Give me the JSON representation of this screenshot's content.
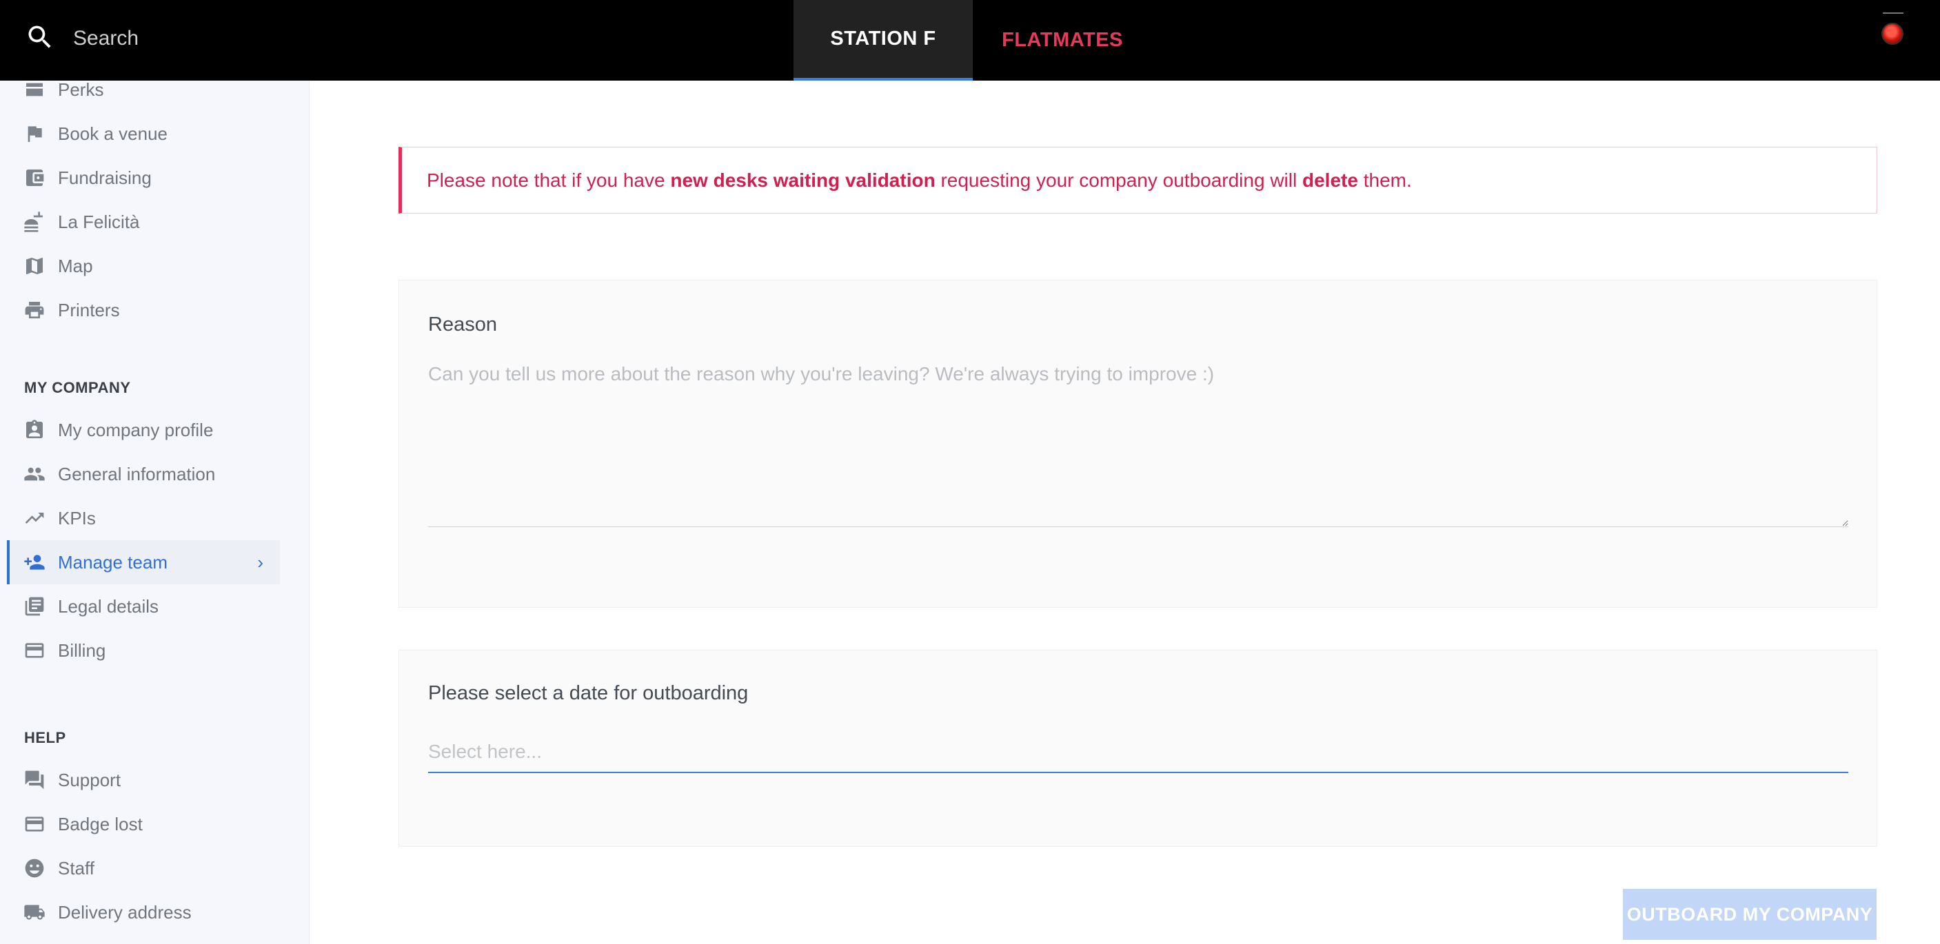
{
  "topbar": {
    "search_placeholder": "Search",
    "tabs": [
      {
        "label": "STATION F",
        "active": true
      },
      {
        "label": "FLATMATES",
        "active": false
      }
    ],
    "colors": {
      "background": "#000000",
      "active_tab_bg": "#222222",
      "accent": "#3b7be6",
      "secondary_tab": "#e8385b"
    }
  },
  "sidebar": {
    "top_items": [
      {
        "label": "Perks",
        "icon": "perks-icon"
      },
      {
        "label": "Book a venue",
        "icon": "flag-icon"
      },
      {
        "label": "Fundraising",
        "icon": "wallet-icon"
      },
      {
        "label": "La Felicità",
        "icon": "food-icon"
      },
      {
        "label": "Map",
        "icon": "map-icon"
      },
      {
        "label": "Printers",
        "icon": "printer-icon"
      }
    ],
    "sections": [
      {
        "title": "MY COMPANY",
        "items": [
          {
            "label": "My company profile",
            "icon": "badge-icon"
          },
          {
            "label": "General information",
            "icon": "people-icon"
          },
          {
            "label": "KPIs",
            "icon": "trending-icon"
          },
          {
            "label": "Manage team",
            "icon": "add-person-icon",
            "active": true
          },
          {
            "label": "Legal details",
            "icon": "library-icon"
          },
          {
            "label": "Billing",
            "icon": "credit-card-icon"
          }
        ]
      },
      {
        "title": "HELP",
        "items": [
          {
            "label": "Support",
            "icon": "chat-icon"
          },
          {
            "label": "Badge lost",
            "icon": "credit-card-icon"
          },
          {
            "label": "Staff",
            "icon": "face-icon"
          },
          {
            "label": "Delivery address",
            "icon": "truck-icon"
          }
        ]
      }
    ],
    "colors": {
      "background": "#f5f7fc",
      "active": "#2f6fd6",
      "text": "#70757d"
    }
  },
  "main": {
    "alert": {
      "prefix": "Please note that if you have ",
      "bold1": "new desks waiting validation",
      "middle": " requesting your company outboarding will ",
      "bold2": "delete",
      "suffix": " them.",
      "color": "#d02050"
    },
    "reason": {
      "label": "Reason",
      "placeholder": "Can you tell us more about the reason why you're leaving? We're always trying to improve :)",
      "value": ""
    },
    "date": {
      "label": "Please select a date for outboarding",
      "placeholder": "Select here..."
    },
    "submit_label": "OUTBOARD MY COMPANY"
  }
}
